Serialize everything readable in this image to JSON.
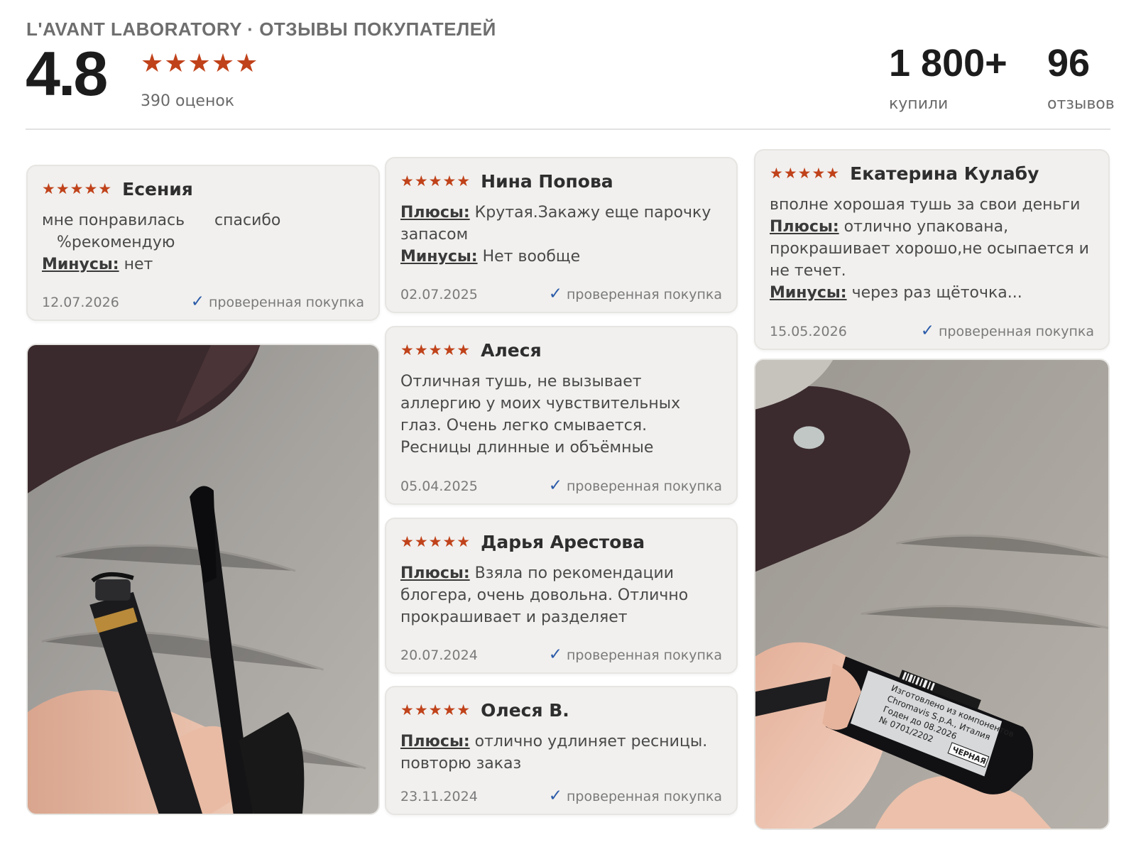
{
  "header": {
    "brand_line": "L'AVANT LABORATORY · ОТЗЫВЫ ПОКУПАТЕЛЕЙ",
    "rating": "4.8",
    "stars": "★★★★★",
    "ratings_count": "390 оценок",
    "stats": [
      {
        "value": "1 800+",
        "label": "купили"
      },
      {
        "value": "96",
        "label": "отзывов"
      }
    ]
  },
  "verified_label": "проверенная покупка",
  "reviews": [
    {
      "name": "Есения",
      "stars": "★★★★★",
      "text_line1": "мне понравилась      спасибо",
      "text_line2": "   %рекомендую",
      "minus_key": "Минусы:",
      "minus": " нет",
      "date": "12.07.2026"
    },
    {
      "name": "Нина Попова",
      "stars": "★★★★★",
      "plus_key": "Плюсы:",
      "plus": " Крутая.Закажу еще парочку запасом",
      "minus_key": "Минусы:",
      "minus": " Нет вообще",
      "date": "02.07.2025"
    },
    {
      "name": "Алеся",
      "stars": "★★★★★",
      "text": "Отличная тушь, не вызывает аллергию у моих чувствительных глаз. Очень легко смывается. Ресницы длинные и объёмные",
      "date": "05.04.2025"
    },
    {
      "name": "Дарья Арестова",
      "stars": "★★★★★",
      "plus_key": "Плюсы:",
      "plus": " Взяла по рекомендации блогера, очень довольна. Отлично прокрашивает и разделяет",
      "date": "20.07.2024"
    },
    {
      "name": "Олеся В.",
      "stars": "★★★★★",
      "plus_key": "Плюсы:",
      "plus": " отлично удлиняет ресницы. повторю заказ",
      "date": "23.11.2024"
    },
    {
      "name": "Екатерина Кулабу",
      "stars": "★★★★★",
      "text": "вполне хорошая тушь за свои деньги",
      "plus_key": "Плюсы:",
      "plus": " отлично упакована, прокрашивает хорошо,не осыпается и не течет.",
      "minus_key": "Минусы:",
      "minus": " через раз щёточка...",
      "date": "15.05.2026"
    }
  ],
  "photo_right_label": {
    "line1": "Изготовлено из компонентов",
    "line2": "Chromavis S.p.A., Италия",
    "line3": "Годен до 08.2026",
    "line4": "№ 0701/2202",
    "shade": "ЧЕРНАЯ"
  },
  "colors": {
    "star": "#c0421a",
    "check": "#2b5aa8",
    "card_bg": "#f1f0ee"
  }
}
